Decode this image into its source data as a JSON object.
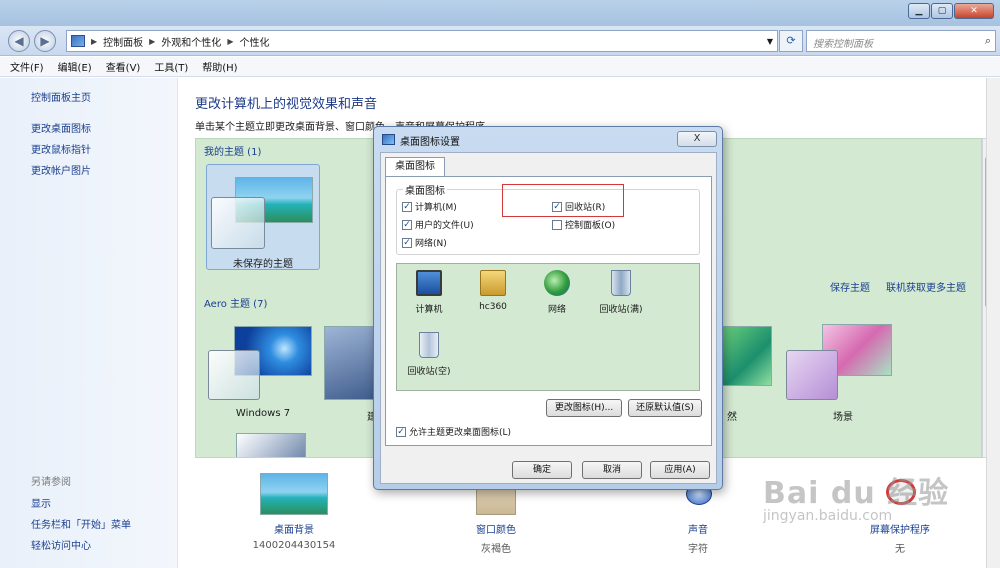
{
  "address": {
    "crumbs": [
      "控制面板",
      "外观和个性化",
      "个性化"
    ],
    "search_placeholder": "搜索控制面板"
  },
  "menu": [
    "文件(F)",
    "编辑(E)",
    "查看(V)",
    "工具(T)",
    "帮助(H)"
  ],
  "sidebar": {
    "home": "控制面板主页",
    "links": [
      "更改桌面图标",
      "更改鼠标指针",
      "更改帐户图片"
    ],
    "see_also_title": "另请参阅",
    "see_also": [
      "显示",
      "任务栏和「开始」菜单",
      "轻松访问中心"
    ]
  },
  "main": {
    "title": "更改计算机上的视觉效果和声音",
    "description": "单击某个主题立即更改桌面背景、窗口颜色、声音和屏幕保护程序",
    "my_themes_label": "我的主题 (1)",
    "unsaved_theme": "未保存的主题",
    "aero_label": "Aero 主题 (7)",
    "aero_themes": [
      "Windows 7",
      "建",
      "然",
      "场景"
    ],
    "save_theme": "保存主题",
    "get_more": "联机获取更多主题"
  },
  "bottom": [
    {
      "label": "桌面背景",
      "value": "1400204430154"
    },
    {
      "label": "窗口颜色",
      "value": "灰褐色"
    },
    {
      "label": "声音",
      "value": "字符"
    },
    {
      "label": "屏幕保护程序",
      "value": "无"
    }
  ],
  "dialog": {
    "title": "桌面图标设置",
    "close": "X",
    "tab": "桌面图标",
    "legend": "桌面图标",
    "checkboxes": [
      {
        "label": "计算机(M)",
        "checked": true
      },
      {
        "label": "回收站(R)",
        "checked": true
      },
      {
        "label": "用户的文件(U)",
        "checked": true
      },
      {
        "label": "控制面板(O)",
        "checked": false
      },
      {
        "label": "网络(N)",
        "checked": true
      }
    ],
    "icons": [
      "计算机",
      "hc360",
      "网络",
      "回收站(满)",
      "回收站(空)"
    ],
    "change_icon": "更改图标(H)...",
    "restore_default": "还原默认值(S)",
    "allow_themes": "允许主题更改桌面图标(L)",
    "ok": "确定",
    "cancel": "取消",
    "apply": "应用(A)"
  },
  "watermark": {
    "big": "Bai du 经验",
    "small": "jingyan.baidu.com"
  },
  "colors": {
    "accent_link": "#1a3f8f",
    "theme_bg": "#d3e9d2",
    "title_blue": "#1e3a8a",
    "highlight_red": "#d23a3a"
  }
}
